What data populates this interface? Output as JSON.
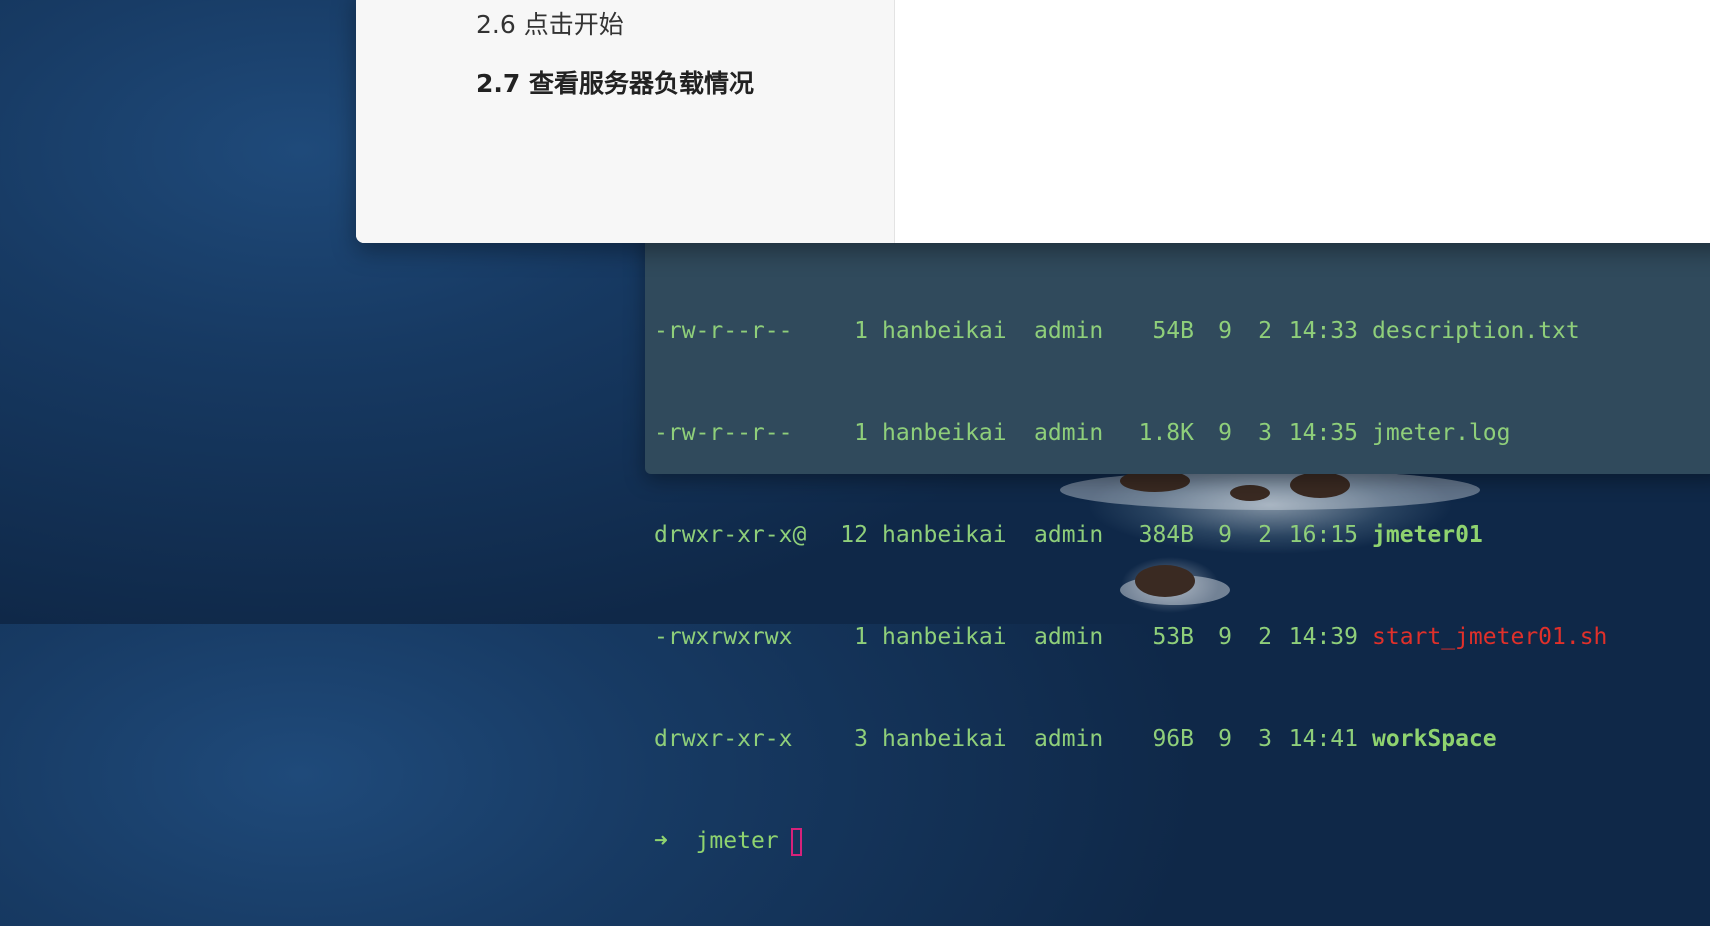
{
  "toc": {
    "items": [
      {
        "label": "2.6 点击开始",
        "active": false
      },
      {
        "label": "2.7 查看服务器负载情况",
        "active": true
      }
    ]
  },
  "terminal": {
    "listing": [
      {
        "perm": "-rw-r--r--",
        "links": "1",
        "owner": "hanbeikai",
        "group": "admin",
        "size": "54B",
        "month": "9",
        "day": "2",
        "time": "14:33",
        "name": "description.txt",
        "kind": "file"
      },
      {
        "perm": "-rw-r--r--",
        "links": "1",
        "owner": "hanbeikai",
        "group": "admin",
        "size": "1.8K",
        "month": "9",
        "day": "3",
        "time": "14:35",
        "name": "jmeter.log",
        "kind": "file"
      },
      {
        "perm": "drwxr-xr-x@",
        "links": "12",
        "owner": "hanbeikai",
        "group": "admin",
        "size": "384B",
        "month": "9",
        "day": "2",
        "time": "16:15",
        "name": "jmeter01",
        "kind": "dir"
      },
      {
        "perm": "-rwxrwxrwx",
        "links": "1",
        "owner": "hanbeikai",
        "group": "admin",
        "size": "53B",
        "month": "9",
        "day": "2",
        "time": "14:39",
        "name": "start_jmeter01.sh",
        "kind": "exec"
      },
      {
        "perm": "drwxr-xr-x",
        "links": "3",
        "owner": "hanbeikai",
        "group": "admin",
        "size": "96B",
        "month": "9",
        "day": "3",
        "time": "14:41",
        "name": "workSpace",
        "kind": "dir"
      }
    ],
    "prompt": {
      "arrow": "➜",
      "dir": "jmeter"
    },
    "colors": {
      "background": "#304a5c",
      "text": "#8fcf7a",
      "dir": "#8fd36f",
      "exec": "#e0302a",
      "cursor": "#d6227a"
    }
  }
}
